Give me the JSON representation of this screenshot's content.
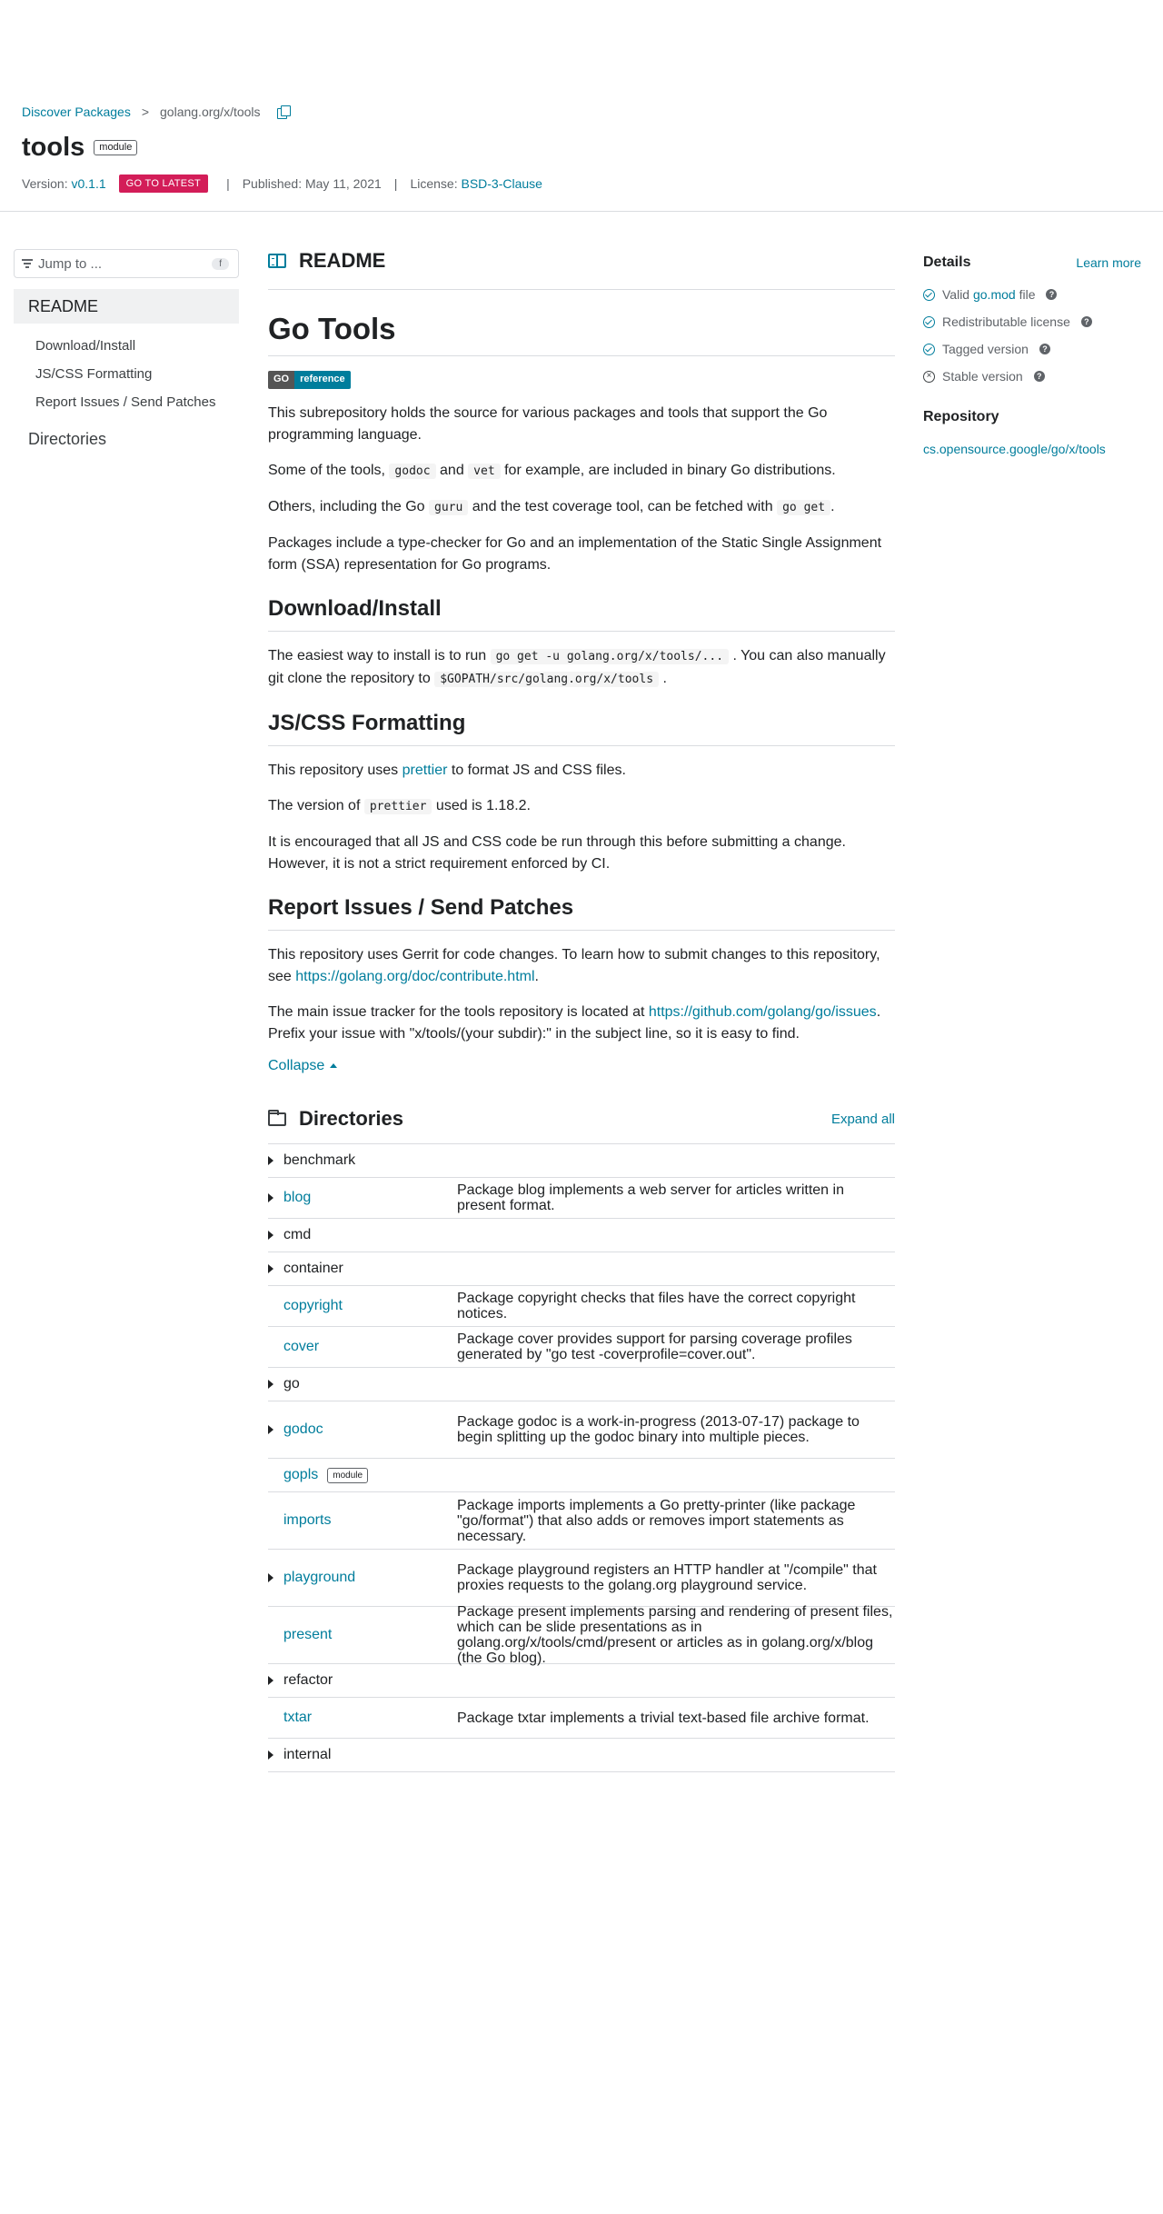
{
  "header": {
    "breadcrumb_root": "Discover Packages",
    "breadcrumb_sep": ">",
    "breadcrumb_current": "golang.org/x/tools",
    "title": "tools",
    "title_badge": "module",
    "version_label": "Version:",
    "version": "v0.1.1",
    "latest_button": "GO TO LATEST",
    "published": "Published: May 11, 2021",
    "license_label": "License:",
    "license": "BSD-3-Clause",
    "separator": "|"
  },
  "leftnav": {
    "jump_placeholder": "Jump to ...",
    "jump_key": "f",
    "readme": "README",
    "items": [
      "Download/Install",
      "JS/CSS Formatting",
      "Report Issues / Send Patches"
    ],
    "directories": "Directories"
  },
  "readme": {
    "heading": "README",
    "title": "Go Tools",
    "badge_left": "GO",
    "badge_right": "reference",
    "p1": "This subrepository holds the source for various packages and tools that support the Go programming language.",
    "p2_a": "Some of the tools,",
    "p2_code1": "godoc",
    "p2_b": "and",
    "p2_code2": "vet",
    "p2_c": "for example, are included in binary Go distributions.",
    "p3_a": "Others, including the Go",
    "p3_code1": "guru",
    "p3_b": "and the test coverage tool, can be fetched with",
    "p3_code2": "go get",
    "p3_c": ".",
    "p4": "Packages include a type-checker for Go and an implementation of the Static Single Assignment form (SSA) representation for Go programs.",
    "h_download": "Download/Install",
    "dl_a": "The easiest way to install is to run",
    "dl_code1": "go get -u golang.org/x/tools/...",
    "dl_b": ". You can also manually git clone the repository to",
    "dl_code2": "$GOPATH/src/golang.org/x/tools",
    "dl_c": ".",
    "h_jscss": "JS/CSS Formatting",
    "js_a": "This repository uses",
    "js_link": "prettier",
    "js_b": "to format JS and CSS files.",
    "js2_a": "The version of",
    "js2_code": "prettier",
    "js2_b": "used is 1.18.2.",
    "js3": "It is encouraged that all JS and CSS code be run through this before submitting a change. However, it is not a strict requirement enforced by CI.",
    "h_report": "Report Issues / Send Patches",
    "rp1_a": "This repository uses Gerrit for code changes. To learn how to submit changes to this repository, see",
    "rp1_link": "https://golang.org/doc/contribute.html",
    "rp1_b": ".",
    "rp2_a": "The main issue tracker for the tools repository is located at",
    "rp2_link": "https://github.com/golang/go/issues",
    "rp2_b": ". Prefix your issue with \"x/tools/(your subdir):\" in the subject line, so it is easy to find.",
    "collapse": "Collapse"
  },
  "directories": {
    "heading": "Directories",
    "expand_all": "Expand all",
    "rows": [
      {
        "name": "benchmark",
        "desc": "",
        "expandable": true,
        "link": false
      },
      {
        "name": "blog",
        "desc": "Package blog implements a web server for articles written in present format.",
        "expandable": true,
        "link": true
      },
      {
        "name": "cmd",
        "desc": "",
        "expandable": true,
        "link": false
      },
      {
        "name": "container",
        "desc": "",
        "expandable": true,
        "link": false
      },
      {
        "name": "copyright",
        "desc": "Package copyright checks that files have the correct copyright notices.",
        "expandable": false,
        "link": true
      },
      {
        "name": "cover",
        "desc": "Package cover provides support for parsing coverage profiles generated by \"go test -coverprofile=cover.out\".",
        "expandable": false,
        "link": true
      },
      {
        "name": "go",
        "desc": "",
        "expandable": true,
        "link": false
      },
      {
        "name": "godoc",
        "desc": "Package godoc is a work-in-progress (2013-07-17) package to begin splitting up the godoc binary into multiple pieces.",
        "expandable": true,
        "link": true
      },
      {
        "name": "gopls",
        "desc": "",
        "expandable": false,
        "link": true,
        "badge": "module"
      },
      {
        "name": "imports",
        "desc": "Package imports implements a Go pretty-printer (like package \"go/format\") that also adds or removes import statements as necessary.",
        "expandable": false,
        "link": true
      },
      {
        "name": "playground",
        "desc": "Package playground registers an HTTP handler at \"/compile\" that proxies requests to the golang.org playground service.",
        "expandable": true,
        "link": true
      },
      {
        "name": "present",
        "desc": "Package present implements parsing and rendering of present files, which can be slide presentations as in golang.org/x/tools/cmd/present or articles as in golang.org/x/blog (the Go blog).",
        "expandable": false,
        "link": true
      },
      {
        "name": "refactor",
        "desc": "",
        "expandable": true,
        "link": false
      },
      {
        "name": "txtar",
        "desc": "Package txtar implements a trivial text-based file archive format.",
        "expandable": false,
        "link": true
      },
      {
        "name": "internal",
        "desc": "",
        "expandable": true,
        "link": false
      }
    ]
  },
  "details": {
    "heading": "Details",
    "learn_more": "Learn more",
    "valid_a": "Valid",
    "valid_link": "go.mod",
    "valid_b": "file",
    "redistributable": "Redistributable license",
    "tagged": "Tagged version",
    "stable": "Stable version",
    "help": "?",
    "repo_heading": "Repository",
    "repo_link": "cs.opensource.google/go/x/tools"
  },
  "colors": {
    "link": "#007d9c",
    "latest_button": "#d31d58"
  }
}
